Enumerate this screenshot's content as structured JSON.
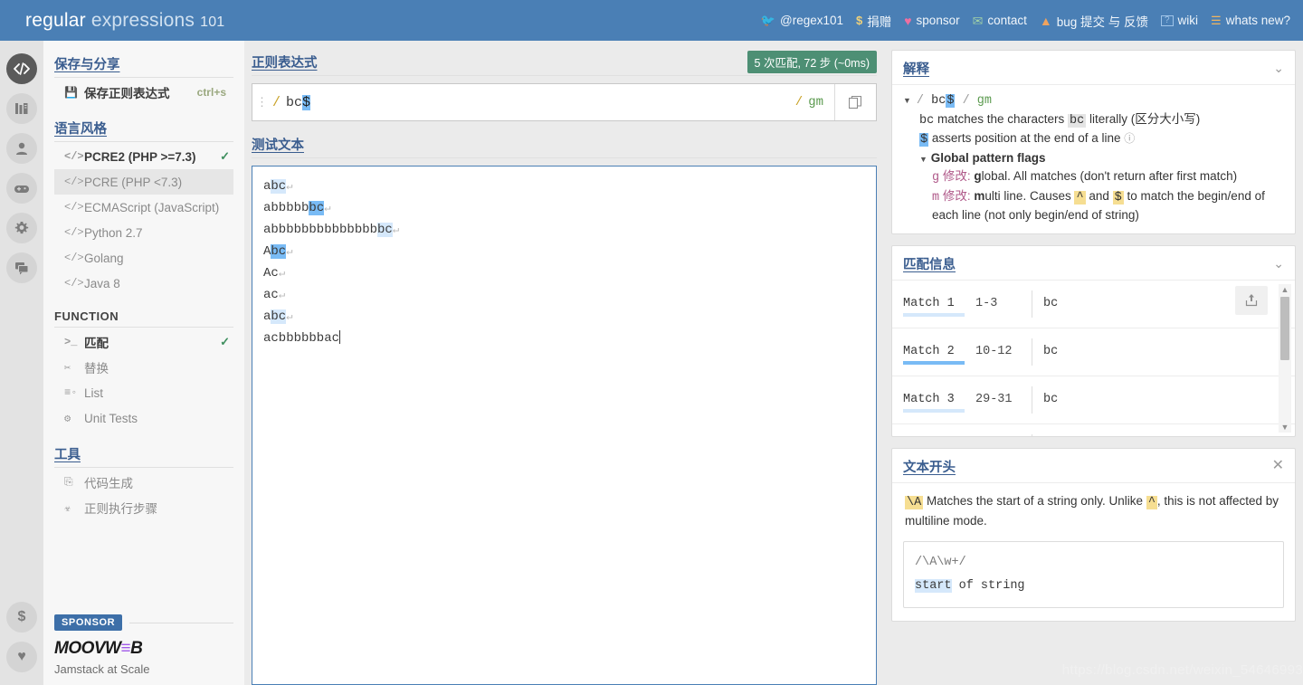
{
  "header": {
    "brand_1": "regular ",
    "brand_2": "expressions ",
    "brand_3": "101",
    "nav": [
      {
        "icon": "twitter-icon",
        "glyph": "🐦",
        "label": "@regex101",
        "color": "#55acee"
      },
      {
        "icon": "dollar-icon",
        "glyph": "$",
        "label": "捐赠",
        "color": "#f0d27a"
      },
      {
        "icon": "heart-icon",
        "glyph": "♥",
        "label": "sponsor",
        "color": "#ef6fa0"
      },
      {
        "icon": "mail-icon",
        "glyph": "✉",
        "label": "contact",
        "color": "#9fd0a8"
      },
      {
        "icon": "warning-icon",
        "glyph": "⚠",
        "label": "bug 提交 与 反馈",
        "color": "#f0a35e"
      },
      {
        "icon": "wiki-icon",
        "glyph": "?",
        "label": "wiki",
        "color": "#9fc4e8"
      },
      {
        "icon": "news-icon",
        "glyph": "☰",
        "label": "whats new?",
        "color": "#f0b45e"
      }
    ]
  },
  "rail": {
    "top_items": [
      {
        "name": "code-icon",
        "active": true
      },
      {
        "name": "library-icon",
        "active": false
      },
      {
        "name": "account-icon",
        "active": false
      },
      {
        "name": "gamepad-icon",
        "active": false
      },
      {
        "name": "gear-icon",
        "active": false
      },
      {
        "name": "chat-icon",
        "active": false
      }
    ],
    "bottom_items": [
      {
        "name": "donate-dollar-icon",
        "glyph": "$"
      },
      {
        "name": "sponsor-heart-icon",
        "glyph": "♥"
      }
    ]
  },
  "sidebar": {
    "save_share": {
      "heading": "保存与分享",
      "items": [
        {
          "icon": "save-icon",
          "glyph": "▤",
          "label": "保存正则表达式",
          "shortcut": "ctrl+s",
          "bold": true
        }
      ]
    },
    "flavor": {
      "heading": "语言风格",
      "items": [
        {
          "icon": "code-tag-icon",
          "glyph": "</>",
          "label": "PCRE2 (PHP >=7.3)",
          "checked": true,
          "bold": true,
          "selected": false
        },
        {
          "icon": "code-tag-icon",
          "glyph": "</>",
          "label": "PCRE (PHP <7.3)",
          "checked": false,
          "bold": false,
          "selected": true
        },
        {
          "icon": "code-tag-icon",
          "glyph": "</>",
          "label": "ECMAScript (JavaScript)",
          "checked": false,
          "bold": false,
          "selected": false
        },
        {
          "icon": "code-tag-icon",
          "glyph": "</>",
          "label": "Python 2.7",
          "checked": false,
          "bold": false,
          "selected": false
        },
        {
          "icon": "code-tag-icon",
          "glyph": "</>",
          "label": "Golang",
          "checked": false,
          "bold": false,
          "selected": false
        },
        {
          "icon": "code-tag-icon",
          "glyph": "</>",
          "label": "Java 8",
          "checked": false,
          "bold": false,
          "selected": false
        }
      ]
    },
    "function": {
      "heading": "FUNCTION",
      "items": [
        {
          "icon": "terminal-icon",
          "glyph": ">_",
          "label": "匹配",
          "checked": true,
          "bold": true
        },
        {
          "icon": "scissors-icon",
          "glyph": "✂",
          "label": "替换",
          "checked": false,
          "bold": false
        },
        {
          "icon": "list-icon",
          "glyph": "≡",
          "label": "List",
          "checked": false,
          "bold": false
        },
        {
          "icon": "test-tube-icon",
          "glyph": "⚗",
          "label": "Unit Tests",
          "checked": false,
          "bold": false
        }
      ]
    },
    "tools": {
      "heading": "工具",
      "items": [
        {
          "icon": "code-gen-icon",
          "glyph": "⬚",
          "label": "代码生成"
        },
        {
          "icon": "debugger-icon",
          "glyph": "☣",
          "label": "正则执行步骤"
        }
      ]
    },
    "sponsor": {
      "tag": "SPONSOR",
      "logo_a": "MOOVW",
      "logo_eq": "≡",
      "logo_b": "B",
      "subtitle": "Jamstack at Scale"
    }
  },
  "regex_section": {
    "title": "正则表达式",
    "match_badge": "5 次匹配, 72 步 (~0ms)",
    "grip_icon": "drag-grip-icon",
    "open_delim": "/",
    "pattern_literal": "bc",
    "pattern_anchor": "$",
    "close_delim": "/",
    "flags": "gm",
    "copy_icon": "copy-icon"
  },
  "test_section": {
    "title": "测试文本",
    "lines": [
      {
        "segments": [
          {
            "t": "a",
            "hl": "none"
          },
          {
            "t": "bc",
            "hl": "light"
          }
        ],
        "newline": true
      },
      {
        "segments": [
          {
            "t": "abbbbb",
            "hl": "none"
          },
          {
            "t": "bc",
            "hl": "dark"
          }
        ],
        "newline": true
      },
      {
        "segments": [
          {
            "t": "abbbbbbbbbbbbbb",
            "hl": "none"
          },
          {
            "t": "bc",
            "hl": "light"
          }
        ],
        "newline": true
      },
      {
        "segments": [
          {
            "t": "A",
            "hl": "none"
          },
          {
            "t": "bc",
            "hl": "dark"
          }
        ],
        "newline": true
      },
      {
        "segments": [
          {
            "t": "Ac",
            "hl": "none"
          }
        ],
        "newline": true
      },
      {
        "segments": [
          {
            "t": "ac",
            "hl": "none"
          }
        ],
        "newline": true
      },
      {
        "segments": [
          {
            "t": "a",
            "hl": "none"
          },
          {
            "t": "bc",
            "hl": "light"
          }
        ],
        "newline": true
      },
      {
        "segments": [
          {
            "t": "acbbbbbbac",
            "hl": "none"
          }
        ],
        "newline": false,
        "caret": true
      }
    ],
    "newline_glyph": "↵"
  },
  "explanation": {
    "title": "解释",
    "collapse_icon": "chevron-down-icon",
    "pattern": {
      "tri": "▼",
      "slash": "/",
      "literal": "bc",
      "anchor": "$",
      "slash2": "/",
      "flags": "gm"
    },
    "lines": [
      {
        "pre": "bc",
        "mid": " matches the characters ",
        "chip": "bc",
        "post": " literally (区分大小写)",
        "chip_style": "grey",
        "pre_style": "plain"
      },
      {
        "pre": "$",
        "mid": " asserts position at the end of a line ",
        "chip": "",
        "post": "",
        "chip_style": "none",
        "pre_style": "blue",
        "help": "?"
      }
    ],
    "flags_heading": "Global pattern flags",
    "flags_tri": "▼",
    "flag_rows": [
      {
        "key": "g",
        "zh": "修改",
        "colon": ":",
        "bold_first": "g",
        "rest": "lobal. All matches (don't return after first match)"
      },
      {
        "key": "m",
        "zh": "修改",
        "colon": ":",
        "bold_first": "m",
        "rest": "ulti line. Causes ",
        "chip_a": "^",
        "mid": " and ",
        "chip_b": "$",
        "tail": " to match the begin/end of each line (not only begin/end of string)"
      }
    ]
  },
  "match_info": {
    "title": "匹配信息",
    "collapse_icon": "chevron-down-icon",
    "share_icon": "share-icon",
    "rows": [
      {
        "name": "Match 1",
        "range": "1-3",
        "value": "bc",
        "underline": "light"
      },
      {
        "name": "Match 2",
        "range": "10-12",
        "value": "bc",
        "underline": "dark"
      },
      {
        "name": "Match 3",
        "range": "29-31",
        "value": "bc",
        "underline": "light"
      }
    ],
    "scroll_up_glyph": "▲",
    "scroll_down_glyph": "▼"
  },
  "reference": {
    "title": "文本开头",
    "close_icon": "close-icon",
    "token": "\\A",
    "text_1": " Matches the start of a string only. Unlike ",
    "token_2": "^",
    "text_2": ", this is not affected by multiline mode.",
    "code_line_1": "/\\A\\w+/",
    "code_hl": "start",
    "code_rest": " of string"
  },
  "watermark": "https://blog.csdn.net/weixin_54646993",
  "colors": {
    "brand_blue": "#4a7fb5",
    "badge_green": "#4d8f74",
    "match_light": "#d5e8fb",
    "match_dark": "#79bbf5",
    "flag_green": "#5b9a4f",
    "slash_yellow": "#c9a227",
    "heading_blue": "#3a5d8f"
  }
}
